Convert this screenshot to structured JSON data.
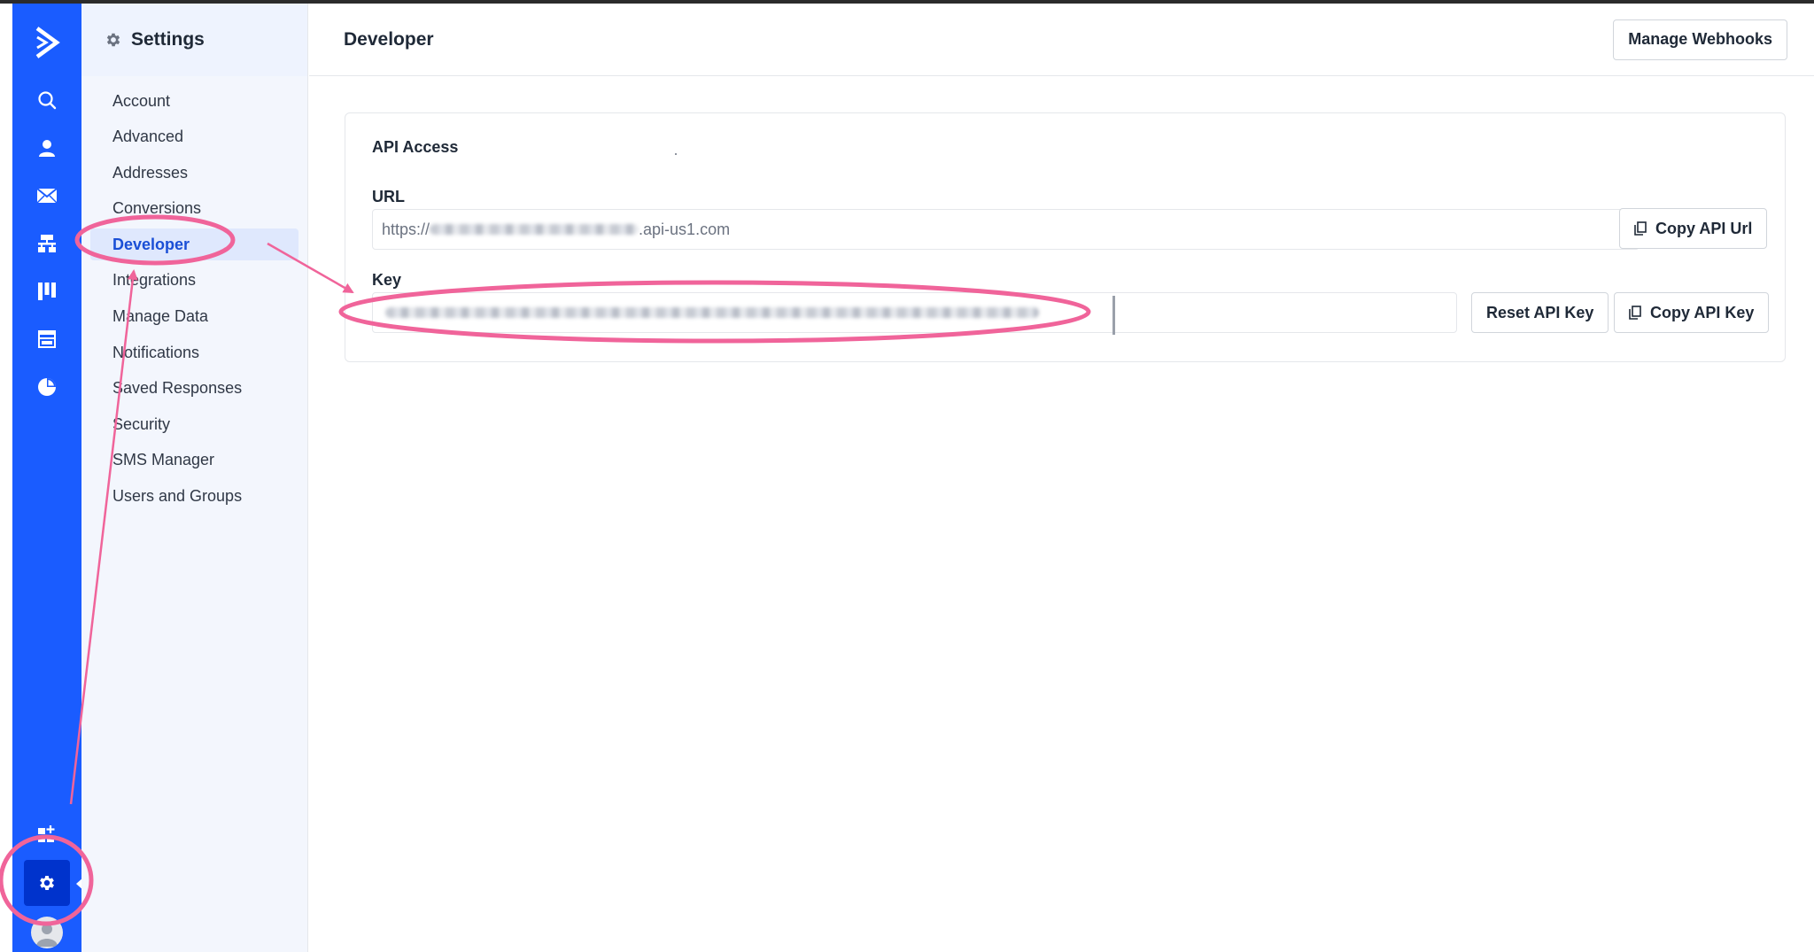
{
  "rail": {
    "icons": [
      "logo-icon",
      "search-icon",
      "contacts-icon",
      "email-icon",
      "automations-icon",
      "deals-icon",
      "site-icon",
      "reports-icon"
    ],
    "apps_icon": "apps-add-icon",
    "settings_icon": "gear-icon",
    "avatar_icon": "user-avatar-icon",
    "color": "#1a5cff"
  },
  "sidebar": {
    "title": "Settings",
    "items": [
      {
        "label": "Account"
      },
      {
        "label": "Advanced"
      },
      {
        "label": "Addresses"
      },
      {
        "label": "Conversions"
      },
      {
        "label": "Developer",
        "active": true
      },
      {
        "label": "Integrations"
      },
      {
        "label": "Manage Data"
      },
      {
        "label": "Notifications"
      },
      {
        "label": "Saved Responses"
      },
      {
        "label": "Security"
      },
      {
        "label": "SMS Manager"
      },
      {
        "label": "Users and Groups"
      }
    ]
  },
  "header": {
    "title": "Developer",
    "webhooks_button": "Manage Webhooks"
  },
  "api_access": {
    "title": "API Access",
    "url_label": "URL",
    "url_prefix": "https://",
    "url_suffix": ".api-us1.com",
    "copy_url_button": "Copy API Url",
    "key_label": "Key",
    "reset_key_button": "Reset API Key",
    "copy_key_button": "Copy API Key",
    "copy_icon": "copy-icon"
  },
  "annotation_color": "#f0649a"
}
